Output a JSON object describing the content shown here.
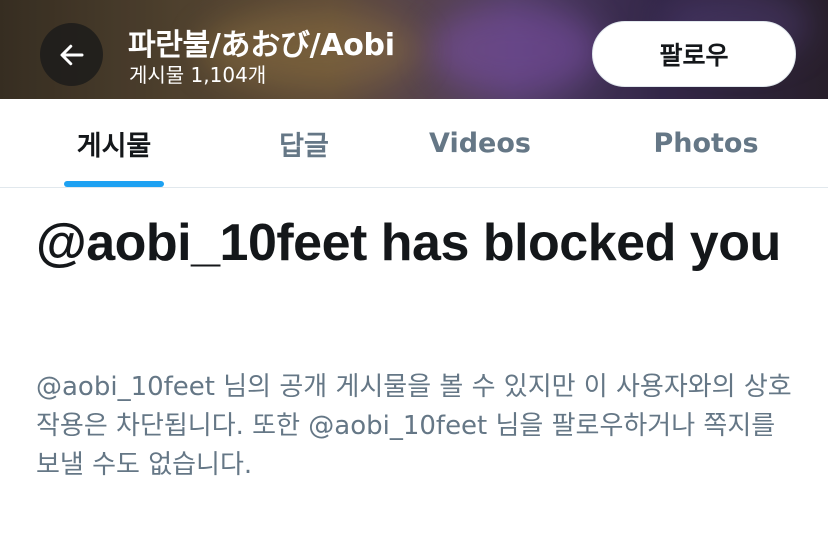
{
  "header": {
    "display_name": "파란불/あおび/Aobi",
    "post_count": "게시물 1,104개",
    "follow_label": "팔로우",
    "back_icon": "arrow-left-icon"
  },
  "tabs": [
    {
      "label": "게시물",
      "active": true
    },
    {
      "label": "답글",
      "active": false
    },
    {
      "label": "Videos",
      "active": false
    },
    {
      "label": "Photos",
      "active": false
    }
  ],
  "blocked": {
    "title": "@aobi_10feet has blocked you",
    "description": "@aobi_10feet 님의 공개 게시물을 볼 수 있지만 이 사용자와의 상호작용은 차단됩니다. 또한 @aobi_10feet 님을 팔로우하거나 쪽지를 보낼 수도 없습니다."
  },
  "colors": {
    "accent": "#1da1f2",
    "primary_text": "#14171a",
    "secondary_text": "#657786"
  }
}
